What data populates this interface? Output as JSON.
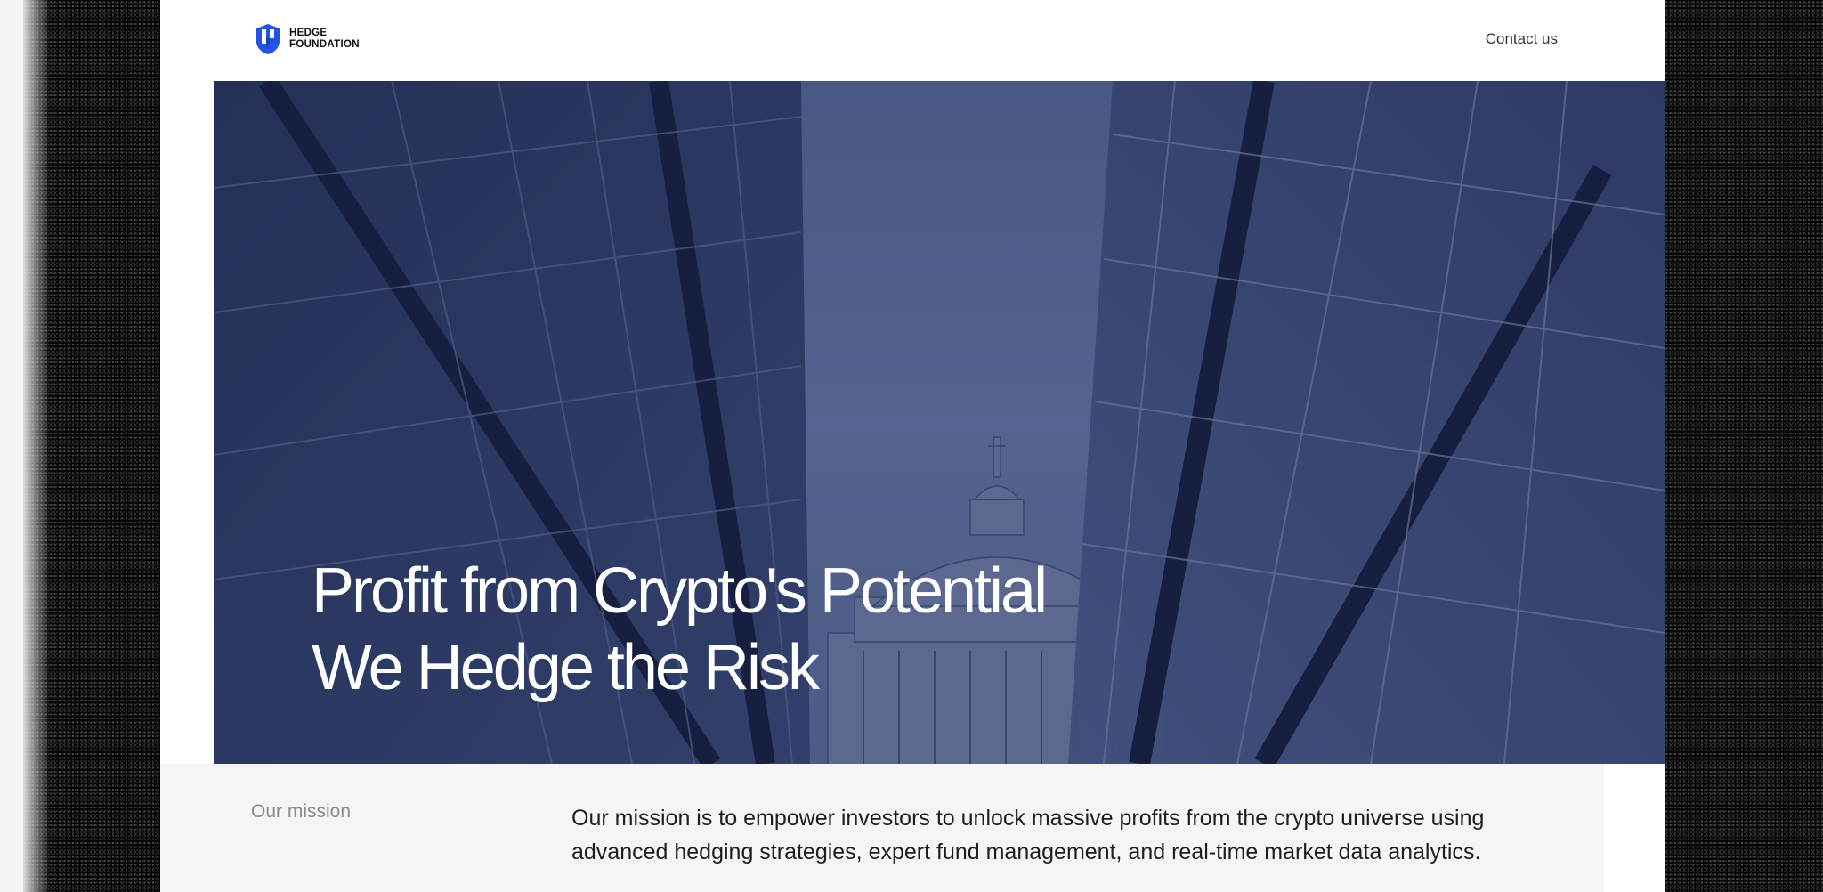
{
  "brand": {
    "line1": "HEDGE",
    "line2": "FOUNDATION",
    "icon": "shield-icon",
    "accent_color": "#2451e6"
  },
  "nav": {
    "contact_label": "Contact us"
  },
  "hero": {
    "title_line1": "Profit from Crypto's Potential",
    "title_line2": "We Hedge the Risk",
    "image": "city-cathedral-glass-buildings-photo",
    "overlay_color": "#4a5888"
  },
  "mission": {
    "label": "Our mission",
    "text": "Our mission is to empower investors to unlock massive profits from the crypto universe using advanced hedging strategies, expert fund management, and real-time market data analytics."
  }
}
